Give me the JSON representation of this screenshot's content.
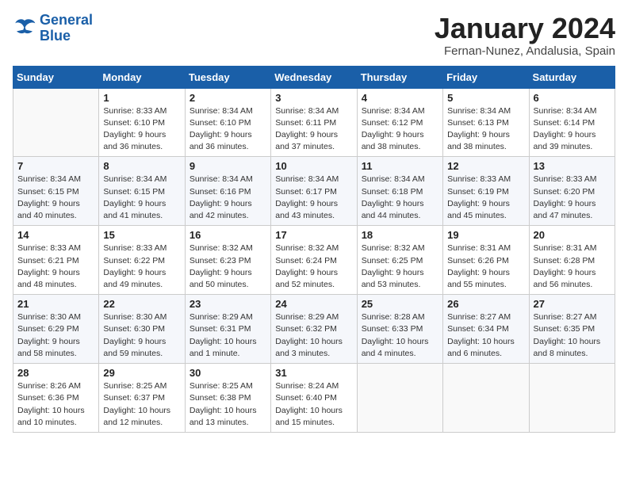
{
  "logo": {
    "line1": "General",
    "line2": "Blue"
  },
  "title": "January 2024",
  "subtitle": "Fernan-Nunez, Andalusia, Spain",
  "days_header": [
    "Sunday",
    "Monday",
    "Tuesday",
    "Wednesday",
    "Thursday",
    "Friday",
    "Saturday"
  ],
  "weeks": [
    [
      {
        "day": "",
        "info": ""
      },
      {
        "day": "1",
        "info": "Sunrise: 8:33 AM\nSunset: 6:10 PM\nDaylight: 9 hours\nand 36 minutes."
      },
      {
        "day": "2",
        "info": "Sunrise: 8:34 AM\nSunset: 6:10 PM\nDaylight: 9 hours\nand 36 minutes."
      },
      {
        "day": "3",
        "info": "Sunrise: 8:34 AM\nSunset: 6:11 PM\nDaylight: 9 hours\nand 37 minutes."
      },
      {
        "day": "4",
        "info": "Sunrise: 8:34 AM\nSunset: 6:12 PM\nDaylight: 9 hours\nand 38 minutes."
      },
      {
        "day": "5",
        "info": "Sunrise: 8:34 AM\nSunset: 6:13 PM\nDaylight: 9 hours\nand 38 minutes."
      },
      {
        "day": "6",
        "info": "Sunrise: 8:34 AM\nSunset: 6:14 PM\nDaylight: 9 hours\nand 39 minutes."
      }
    ],
    [
      {
        "day": "7",
        "info": "Sunrise: 8:34 AM\nSunset: 6:15 PM\nDaylight: 9 hours\nand 40 minutes."
      },
      {
        "day": "8",
        "info": "Sunrise: 8:34 AM\nSunset: 6:15 PM\nDaylight: 9 hours\nand 41 minutes."
      },
      {
        "day": "9",
        "info": "Sunrise: 8:34 AM\nSunset: 6:16 PM\nDaylight: 9 hours\nand 42 minutes."
      },
      {
        "day": "10",
        "info": "Sunrise: 8:34 AM\nSunset: 6:17 PM\nDaylight: 9 hours\nand 43 minutes."
      },
      {
        "day": "11",
        "info": "Sunrise: 8:34 AM\nSunset: 6:18 PM\nDaylight: 9 hours\nand 44 minutes."
      },
      {
        "day": "12",
        "info": "Sunrise: 8:33 AM\nSunset: 6:19 PM\nDaylight: 9 hours\nand 45 minutes."
      },
      {
        "day": "13",
        "info": "Sunrise: 8:33 AM\nSunset: 6:20 PM\nDaylight: 9 hours\nand 47 minutes."
      }
    ],
    [
      {
        "day": "14",
        "info": "Sunrise: 8:33 AM\nSunset: 6:21 PM\nDaylight: 9 hours\nand 48 minutes."
      },
      {
        "day": "15",
        "info": "Sunrise: 8:33 AM\nSunset: 6:22 PM\nDaylight: 9 hours\nand 49 minutes."
      },
      {
        "day": "16",
        "info": "Sunrise: 8:32 AM\nSunset: 6:23 PM\nDaylight: 9 hours\nand 50 minutes."
      },
      {
        "day": "17",
        "info": "Sunrise: 8:32 AM\nSunset: 6:24 PM\nDaylight: 9 hours\nand 52 minutes."
      },
      {
        "day": "18",
        "info": "Sunrise: 8:32 AM\nSunset: 6:25 PM\nDaylight: 9 hours\nand 53 minutes."
      },
      {
        "day": "19",
        "info": "Sunrise: 8:31 AM\nSunset: 6:26 PM\nDaylight: 9 hours\nand 55 minutes."
      },
      {
        "day": "20",
        "info": "Sunrise: 8:31 AM\nSunset: 6:28 PM\nDaylight: 9 hours\nand 56 minutes."
      }
    ],
    [
      {
        "day": "21",
        "info": "Sunrise: 8:30 AM\nSunset: 6:29 PM\nDaylight: 9 hours\nand 58 minutes."
      },
      {
        "day": "22",
        "info": "Sunrise: 8:30 AM\nSunset: 6:30 PM\nDaylight: 9 hours\nand 59 minutes."
      },
      {
        "day": "23",
        "info": "Sunrise: 8:29 AM\nSunset: 6:31 PM\nDaylight: 10 hours\nand 1 minute."
      },
      {
        "day": "24",
        "info": "Sunrise: 8:29 AM\nSunset: 6:32 PM\nDaylight: 10 hours\nand 3 minutes."
      },
      {
        "day": "25",
        "info": "Sunrise: 8:28 AM\nSunset: 6:33 PM\nDaylight: 10 hours\nand 4 minutes."
      },
      {
        "day": "26",
        "info": "Sunrise: 8:27 AM\nSunset: 6:34 PM\nDaylight: 10 hours\nand 6 minutes."
      },
      {
        "day": "27",
        "info": "Sunrise: 8:27 AM\nSunset: 6:35 PM\nDaylight: 10 hours\nand 8 minutes."
      }
    ],
    [
      {
        "day": "28",
        "info": "Sunrise: 8:26 AM\nSunset: 6:36 PM\nDaylight: 10 hours\nand 10 minutes."
      },
      {
        "day": "29",
        "info": "Sunrise: 8:25 AM\nSunset: 6:37 PM\nDaylight: 10 hours\nand 12 minutes."
      },
      {
        "day": "30",
        "info": "Sunrise: 8:25 AM\nSunset: 6:38 PM\nDaylight: 10 hours\nand 13 minutes."
      },
      {
        "day": "31",
        "info": "Sunrise: 8:24 AM\nSunset: 6:40 PM\nDaylight: 10 hours\nand 15 minutes."
      },
      {
        "day": "",
        "info": ""
      },
      {
        "day": "",
        "info": ""
      },
      {
        "day": "",
        "info": ""
      }
    ]
  ]
}
